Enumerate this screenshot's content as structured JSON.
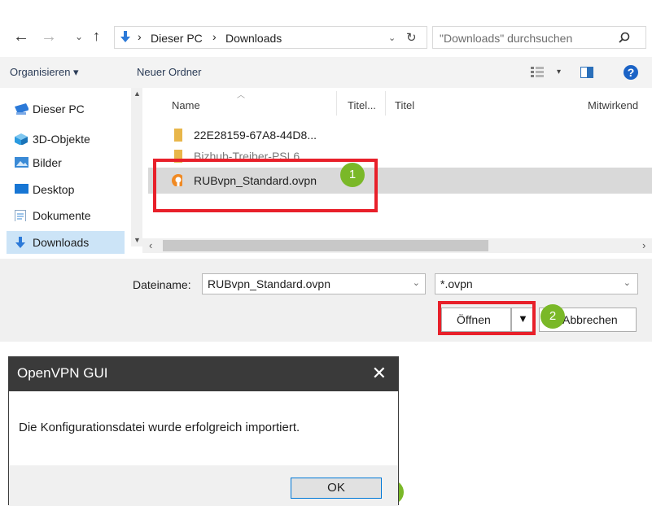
{
  "file_dialog": {
    "title_hint": "Fenster",
    "breadcrumb": [
      "Dieser PC",
      "Downloads"
    ],
    "search_placeholder": "\"Downloads\" durchsuchen",
    "toolbar": {
      "organize": "Organisieren ▾",
      "new_folder": "Neuer Ordner"
    },
    "nav_items": [
      {
        "label": "Dieser PC",
        "icon": "computer-icon"
      },
      {
        "label": "3D-Objekte",
        "icon": "cube-icon"
      },
      {
        "label": "Bilder",
        "icon": "pictures-icon"
      },
      {
        "label": "Desktop",
        "icon": "desktop-icon"
      },
      {
        "label": "Dokumente",
        "icon": "documents-icon"
      },
      {
        "label": "Downloads",
        "icon": "download-icon"
      }
    ],
    "columns": [
      "Name",
      "Titel...",
      "Titel",
      "Mitwirkend"
    ],
    "files": [
      {
        "name": "22E28159-67A8-44D8...",
        "icon": "folder-icon"
      },
      {
        "name": "Bizhub-Treiber-PSL6",
        "icon": "folder-icon"
      },
      {
        "name": "RUBvpn_Standard.ovpn",
        "icon": "openvpn-file-icon"
      }
    ],
    "filename_label": "Dateiname:",
    "filename_value": "RUBvpn_Standard.ovpn",
    "filter_value": "*.ovpn",
    "open_label": "Öffnen",
    "cancel_label": "Abbrechen"
  },
  "vpn_dialog": {
    "title": "OpenVPN GUI",
    "close_glyph": "✕",
    "message": "Die Konfigurationsdatei wurde erfolgreich importiert.",
    "ok_label": "OK"
  },
  "markers": [
    "1",
    "2",
    "3"
  ],
  "colors": {
    "highlight": "#e8202a",
    "marker": "#7ab828",
    "selection": "#cce4f7",
    "vpn_titlebar": "#3a3a3a"
  }
}
